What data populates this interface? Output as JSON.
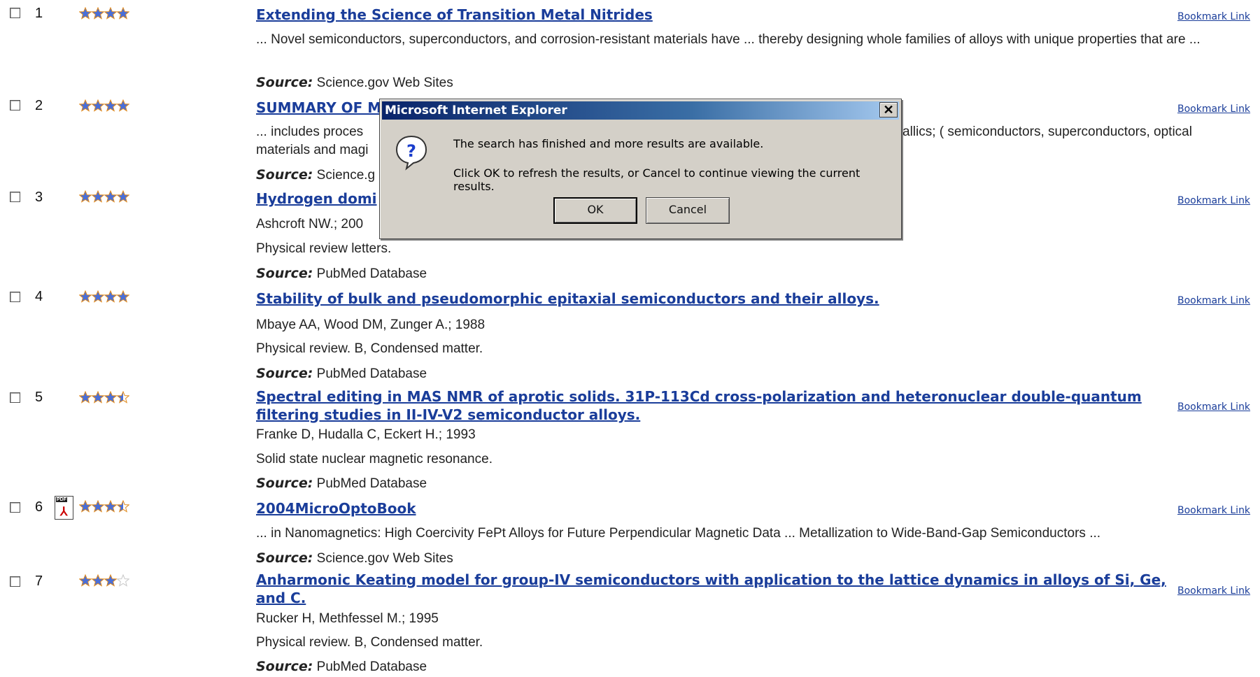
{
  "results": [
    {
      "num": "1",
      "stars": 4,
      "title": "Extending the Science of Transition Metal Nitrides",
      "snippet": "... Novel semiconductors, superconductors, and corrosion-resistant materials have ... thereby designing whole families of alloys with unique properties that are ...",
      "source_label": "Source:",
      "source": "Science.gov Web Sites",
      "bookmark": "Bookmark Link"
    },
    {
      "num": "2",
      "stars": 4,
      "title": "SUMMARY OF M",
      "snippet_a": "... includes proces",
      "snippet_b": "allics; ( semiconductors, superconductors, optical",
      "snippet_c": "materials and magi",
      "source_label": "Source:",
      "source": "Science.g",
      "bookmark": "Bookmark Link"
    },
    {
      "num": "3",
      "stars": 4,
      "title": "Hydrogen domi",
      "authors": "Ashcroft NW.; 200",
      "journal": "Physical review letters.",
      "source_label": "Source:",
      "source": "PubMed Database",
      "bookmark": "Bookmark Link"
    },
    {
      "num": "4",
      "stars": 4,
      "title": "Stability of bulk and pseudomorphic epitaxial semiconductors and their alloys.",
      "authors": "Mbaye AA, Wood DM, Zunger A.; 1988",
      "journal": "Physical review. B, Condensed matter.",
      "source_label": "Source:",
      "source": "PubMed Database",
      "bookmark": "Bookmark Link"
    },
    {
      "num": "5",
      "stars": 3.5,
      "title": "Spectral editing in MAS NMR of aprotic solids. 31P-113Cd cross-polarization and heteronuclear double-quantum filtering studies in II-IV-V2 semiconductor alloys.",
      "authors": "Franke D, Hudalla C, Eckert H.; 1993",
      "journal": "Solid state nuclear magnetic resonance.",
      "source_label": "Source:",
      "source": "PubMed Database",
      "bookmark": "Bookmark Link"
    },
    {
      "num": "6",
      "stars": 3.5,
      "title": "2004MicroOptoBook",
      "snippet": "... in Nanomagnetics: High Coercivity FePt Alloys for Future Perpendicular Magnetic Data ... Metallization to Wide-Band-Gap Semiconductors ...",
      "source_label": "Source:",
      "source": "Science.gov Web Sites",
      "bookmark": "Bookmark Link",
      "pdf_label": "PDF"
    },
    {
      "num": "7",
      "stars": 3,
      "title": "Anharmonic Keating model for group-IV semiconductors with application to the lattice dynamics in alloys of Si, Ge, and C.",
      "authors": "Rucker H, Methfessel M.; 1995",
      "journal": "Physical review. B, Condensed matter.",
      "source_label": "Source:",
      "source": "PubMed Database",
      "bookmark": "Bookmark Link"
    }
  ],
  "dialog": {
    "title": "Microsoft Internet Explorer",
    "close": "✕",
    "message1": "The search has finished and more results are available.",
    "message2": "Click OK to refresh the results, or Cancel to continue viewing the current results.",
    "ok": "OK",
    "cancel": "Cancel"
  },
  "colors": {
    "link": "#1a3d9a",
    "star": "#4a6fd8",
    "star_outline": "#e08a1e"
  },
  "icons": {
    "star": "star-icon",
    "question": "question-icon",
    "pdf": "pdf-icon",
    "close": "close-icon"
  }
}
